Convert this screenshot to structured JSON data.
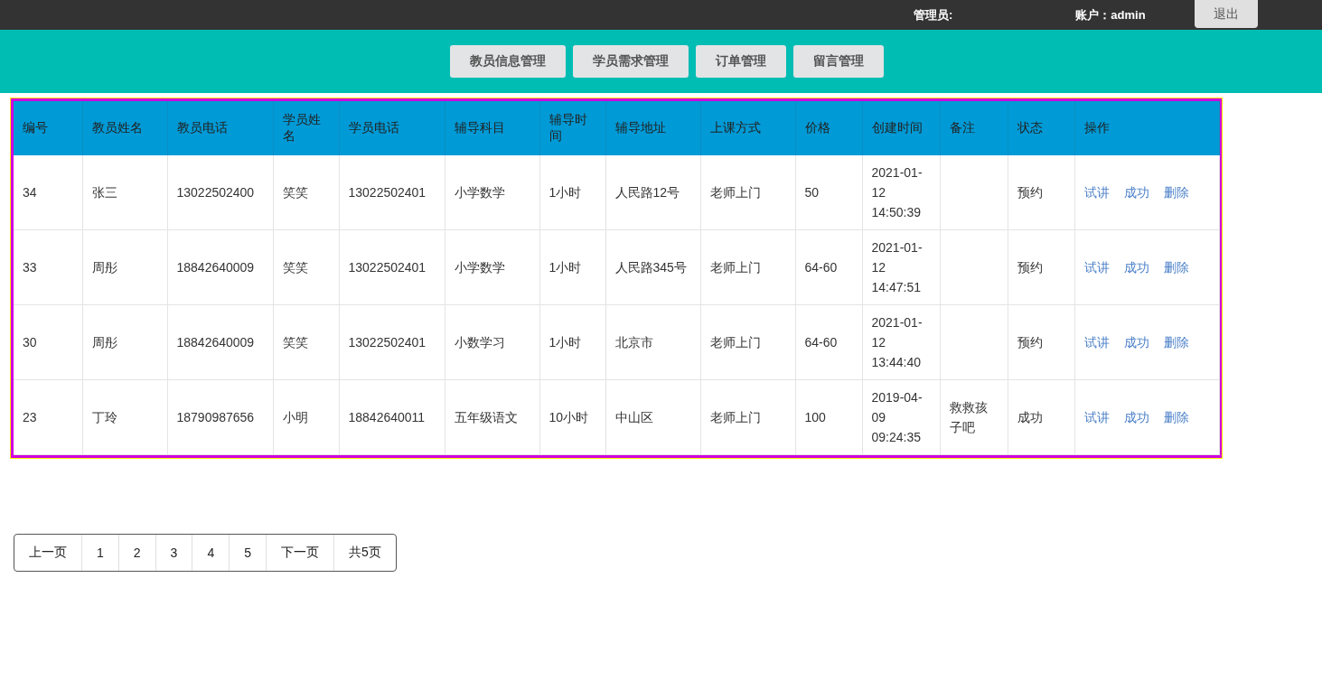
{
  "top_bar": {
    "admin_label": "管理员:",
    "account_label": "账户：admin",
    "logout_button": "退出"
  },
  "nav": [
    "教员信息管理",
    "学员需求管理",
    "订单管理",
    "留言管理"
  ],
  "table": {
    "columns": [
      "编号",
      "教员姓名",
      "教员电话",
      "学员姓名",
      "学员电话",
      "辅导科目",
      "辅导时间",
      "辅导地址",
      "上课方式",
      "价格",
      "创建时间",
      "备注",
      "状态",
      "操作"
    ],
    "rows": [
      {
        "cells": [
          "34",
          "张三",
          "13022502400",
          "笑笑",
          "13022502401",
          "小学数学",
          "1小时",
          "人民路12号",
          "老师上门",
          "50",
          "2021-01-12 14:50:39",
          "",
          "预约"
        ],
        "actions": [
          "试讲",
          "成功",
          "删除"
        ]
      },
      {
        "cells": [
          "33",
          "周彤",
          "18842640009",
          "笑笑",
          "13022502401",
          "小学数学",
          "1小时",
          "人民路345号",
          "老师上门",
          "64-60",
          "2021-01-12 14:47:51",
          "",
          "预约"
        ],
        "actions": [
          "试讲",
          "成功",
          "删除"
        ]
      },
      {
        "cells": [
          "30",
          "周彤",
          "18842640009",
          "笑笑",
          "13022502401",
          "小数学习",
          "1小时",
          "北京市",
          "老师上门",
          "64-60",
          "2021-01-12 13:44:40",
          "",
          "预约"
        ],
        "actions": [
          "试讲",
          "成功",
          "删除"
        ]
      },
      {
        "cells": [
          "23",
          "丁玲",
          "18790987656",
          "小明",
          "18842640011",
          "五年级语文",
          "10小时",
          "中山区",
          "老师上门",
          "100",
          "2019-04-09 09:24:35",
          "救救孩子吧",
          "成功"
        ],
        "actions": [
          "试讲",
          "成功",
          "删除"
        ]
      }
    ]
  },
  "pagination": [
    "上一页",
    "1",
    "2",
    "3",
    "4",
    "5",
    "下一页",
    "共5页"
  ]
}
